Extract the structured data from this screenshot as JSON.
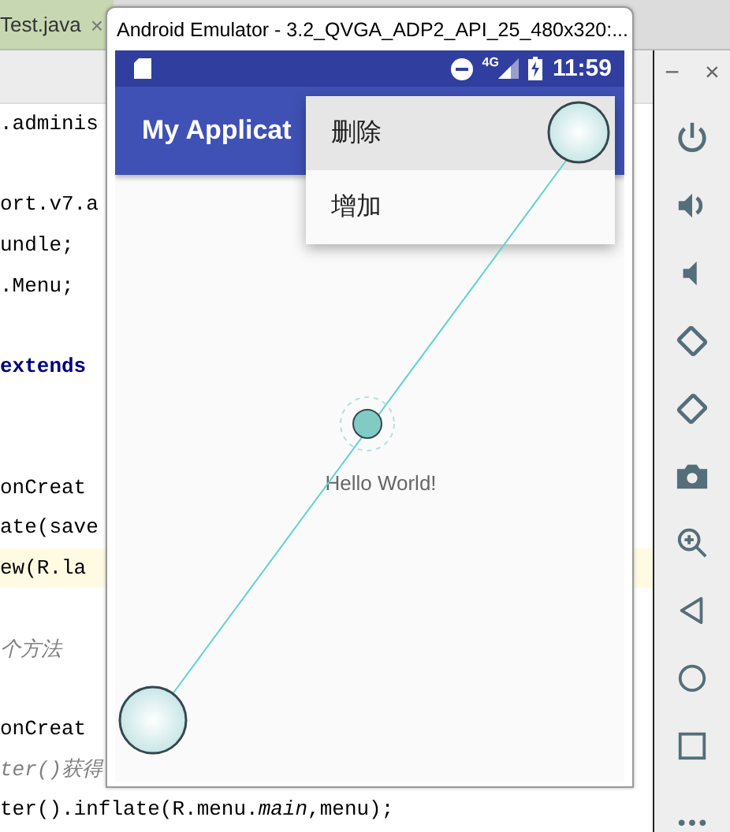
{
  "editor": {
    "tab": {
      "label": "Test.java",
      "close": "×"
    },
    "lines": [
      {
        "kind": "code",
        "text": ".adminis"
      },
      {
        "kind": "blank"
      },
      {
        "kind": "code",
        "text": "ort.v7.a"
      },
      {
        "kind": "code",
        "text": "undle;"
      },
      {
        "kind": "code",
        "text": ".Menu;"
      },
      {
        "kind": "blank"
      },
      {
        "kind": "keyword",
        "text": "extends"
      },
      {
        "kind": "blank"
      },
      {
        "kind": "blank"
      },
      {
        "kind": "code",
        "text": " onCreat"
      },
      {
        "kind": "code",
        "text": "ate(save"
      },
      {
        "kind": "current",
        "text": "ew(R.la"
      },
      {
        "kind": "blank"
      },
      {
        "kind": "comment",
        "text": "个方法"
      },
      {
        "kind": "blank"
      },
      {
        "kind": "code",
        "text": " onCreat"
      },
      {
        "kind": "comment",
        "text": "ter()获得"
      },
      {
        "kind": "code",
        "text": "ter().inflate(R.menu.*main*,menu);"
      }
    ]
  },
  "emulator": {
    "title": "Android Emulator - 3.2_QVGA_ADP2_API_25_480x320:...",
    "status_bar": {
      "network": "4G",
      "time": "11:59"
    },
    "app_bar": {
      "title": "My Applicat"
    },
    "content": {
      "text": "Hello World!"
    },
    "menu": [
      {
        "label": "删除",
        "pressed": true
      },
      {
        "label": "增加",
        "pressed": false
      }
    ]
  },
  "toolbar": {
    "minimize": "−",
    "close": "×"
  }
}
